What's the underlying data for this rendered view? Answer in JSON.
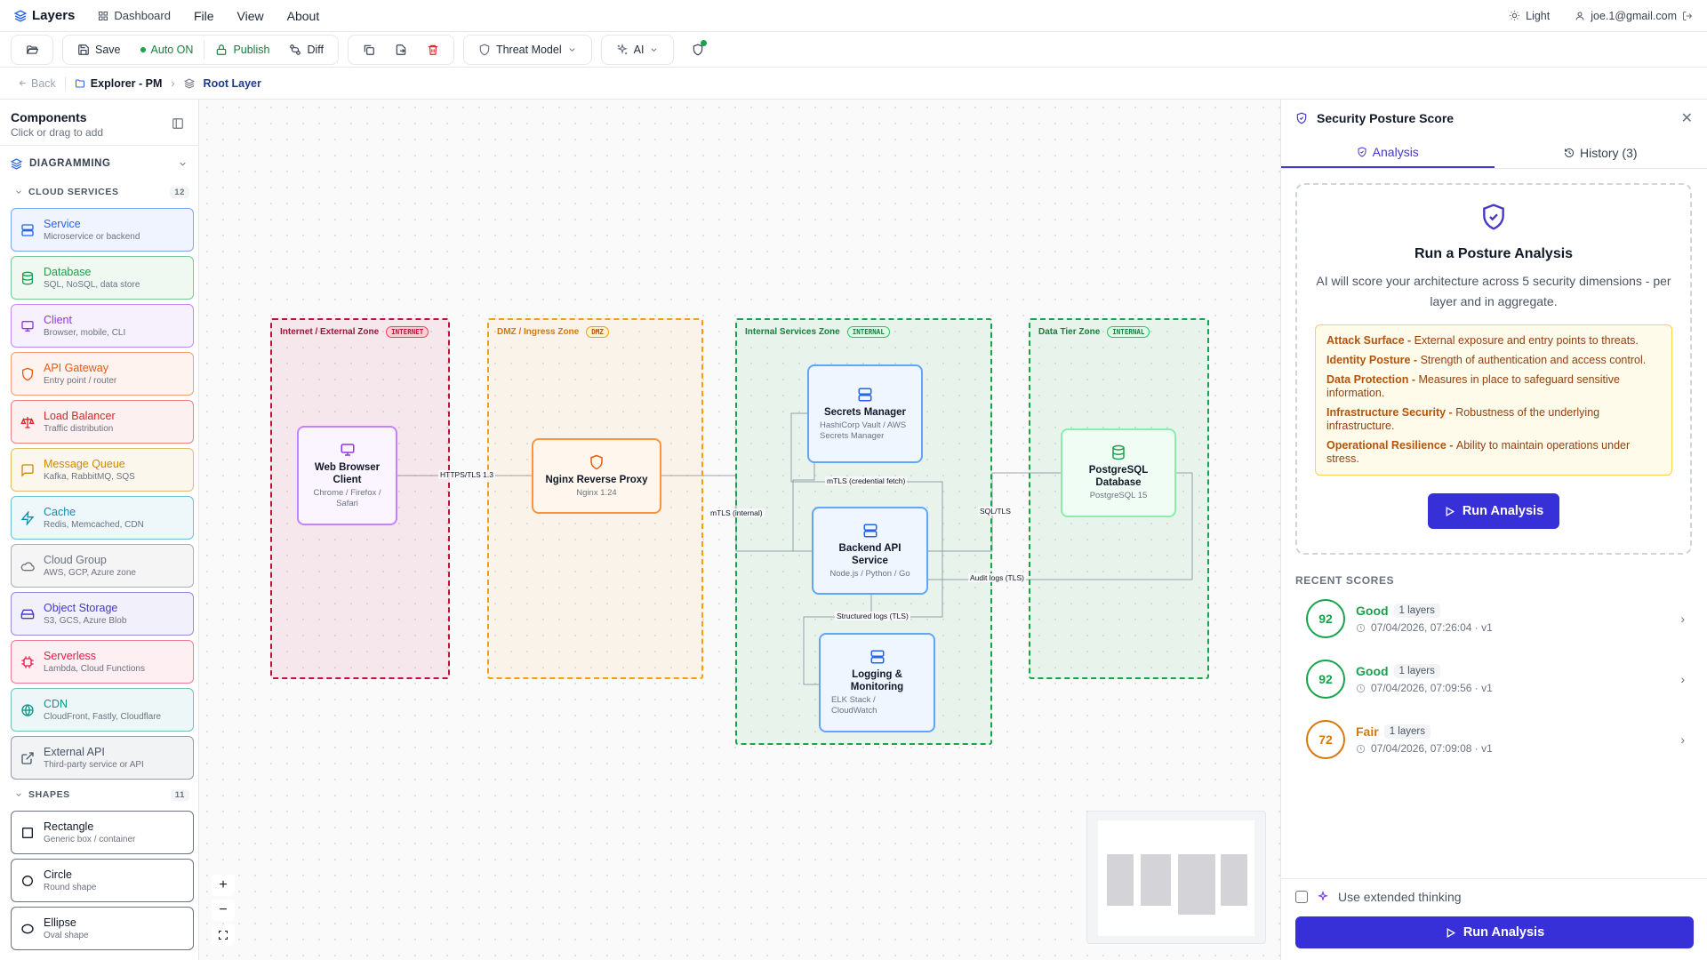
{
  "menubar": {
    "brand": "Layers",
    "dashboard": "Dashboard",
    "menus": [
      "File",
      "View",
      "About"
    ],
    "theme": "Light",
    "user": "joe.1@gmail.com"
  },
  "toolbar": {
    "save": "Save",
    "autosave": "Auto ON",
    "publish": "Publish",
    "diff": "Diff",
    "threat_model": "Threat Model",
    "ai": "AI"
  },
  "breadcrumb": {
    "back": "Back",
    "project": "Explorer - PM",
    "current": "Root Layer"
  },
  "sidebar": {
    "title": "Components",
    "subtitle": "Click or drag to add",
    "category": "DIAGRAMMING",
    "cloud_services": {
      "label": "CLOUD SERVICES",
      "count": "12",
      "items": [
        {
          "label": "Service",
          "desc": "Microservice or backend",
          "color": "#2563eb",
          "icon": "server-icon"
        },
        {
          "label": "Database",
          "desc": "SQL, NoSQL, data store",
          "color": "#16a34a",
          "icon": "database-icon"
        },
        {
          "label": "Client",
          "desc": "Browser, mobile, CLI",
          "color": "#9333ea",
          "icon": "monitor-icon"
        },
        {
          "label": "API Gateway",
          "desc": "Entry point / router",
          "color": "#ea580c",
          "icon": "shield-icon"
        },
        {
          "label": "Load Balancer",
          "desc": "Traffic distribution",
          "color": "#dc2626",
          "icon": "scale-icon"
        },
        {
          "label": "Message Queue",
          "desc": "Kafka, RabbitMQ, SQS",
          "color": "#ca8a04",
          "icon": "message-icon"
        },
        {
          "label": "Cache",
          "desc": "Redis, Memcached, CDN",
          "color": "#0891b2",
          "icon": "zap-icon"
        },
        {
          "label": "Cloud Group",
          "desc": "AWS, GCP, Azure zone",
          "color": "#6b7280",
          "icon": "cloud-icon"
        },
        {
          "label": "Object Storage",
          "desc": "S3, GCS, Azure Blob",
          "color": "#4338ca",
          "icon": "storage-icon"
        },
        {
          "label": "Serverless",
          "desc": "Lambda, Cloud Functions",
          "color": "#e11d48",
          "icon": "chip-icon"
        },
        {
          "label": "CDN",
          "desc": "CloudFront, Fastly, Cloudflare",
          "color": "#0d9488",
          "icon": "globe-icon"
        },
        {
          "label": "External API",
          "desc": "Third-party service or API",
          "color": "#475569",
          "icon": "external-link-icon"
        }
      ]
    },
    "shapes": {
      "label": "SHAPES",
      "count": "11",
      "items": [
        {
          "label": "Rectangle",
          "desc": "Generic box / container"
        },
        {
          "label": "Circle",
          "desc": "Round shape"
        },
        {
          "label": "Ellipse",
          "desc": "Oval shape"
        }
      ]
    }
  },
  "diagram": {
    "zones": [
      {
        "label": "Internet / External Zone",
        "badge": "INTERNET",
        "color": "#be123c"
      },
      {
        "label": "DMZ / Ingress Zone",
        "badge": "DMZ",
        "color": "#f59e0b"
      },
      {
        "label": "Internal Services Zone",
        "badge": "INTERNAL",
        "color": "#16a34a"
      },
      {
        "label": "Data Tier Zone",
        "badge": "INTERNAL",
        "color": "#16a34a"
      }
    ],
    "nodes": {
      "browser": {
        "title": "Web Browser Client",
        "sub": "Chrome / Firefox / Safari"
      },
      "nginx": {
        "title": "Nginx Reverse Proxy",
        "sub": "Nginx 1.24"
      },
      "secrets": {
        "title": "Secrets Manager",
        "sub": "HashiCorp Vault / AWS Secrets Manager"
      },
      "backend": {
        "title": "Backend API Service",
        "sub": "Node.js / Python / Go"
      },
      "logging": {
        "title": "Logging & Monitoring",
        "sub": "ELK Stack / CloudWatch"
      },
      "postgres": {
        "title": "PostgreSQL Database",
        "sub": "PostgreSQL 15"
      }
    },
    "edges": {
      "https": "HTTPS/TLS 1.3",
      "mtls_internal": "mTLS (internal)",
      "mtls_secret": "mTLS (credential fetch)",
      "sql": "SQL/TLS",
      "audit": "Audit logs (TLS)",
      "structured": "Structured logs (TLS)"
    }
  },
  "panel": {
    "title": "Security Posture Score",
    "tab_analysis": "Analysis",
    "tab_history": "History (3)",
    "run_title": "Run a Posture Analysis",
    "run_desc": "AI will score your architecture across 5 security dimensions - per layer and in aggregate.",
    "dimensions": [
      {
        "name": "Attack Surface - ",
        "desc": "External exposure and entry points to threats."
      },
      {
        "name": "Identity Posture - ",
        "desc": "Strength of authentication and access control."
      },
      {
        "name": "Data Protection - ",
        "desc": "Measures in place to safeguard sensitive information."
      },
      {
        "name": "Infrastructure Security - ",
        "desc": "Robustness of the underlying infrastructure."
      },
      {
        "name": "Operational Resilience - ",
        "desc": "Ability to maintain operations under stress."
      }
    ],
    "run_button": "Run Analysis",
    "recent_label": "RECENT SCORES",
    "scores": [
      {
        "value": "92",
        "label": "Good",
        "layers": "1 layers",
        "time": "07/04/2026, 07:26:04 · v1",
        "color": "#16a34a"
      },
      {
        "value": "92",
        "label": "Good",
        "layers": "1 layers",
        "time": "07/04/2026, 07:09:56 · v1",
        "color": "#16a34a"
      },
      {
        "value": "72",
        "label": "Fair",
        "layers": "1 layers",
        "time": "07/04/2026, 07:09:08 · v1",
        "color": "#d97706"
      }
    ],
    "extended_thinking": "Use extended thinking",
    "footer_button": "Run Analysis"
  }
}
